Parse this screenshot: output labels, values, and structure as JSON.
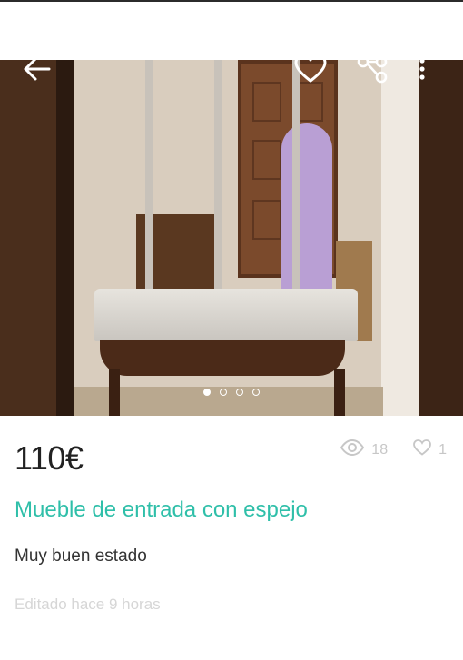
{
  "listing": {
    "price": "110€",
    "title": "Mueble de entrada con espejo",
    "description": "Muy buen estado",
    "edited": "Editado hace 9 horas",
    "views": "18",
    "favorites": "1"
  },
  "gallery": {
    "image_count": 4,
    "active_index": 0
  },
  "icons": {
    "back": "back-arrow-icon",
    "favorite": "heart-icon",
    "share": "share-icon",
    "more": "more-vertical-icon",
    "views": "eye-icon",
    "favorites_count": "heart-outline-icon"
  },
  "colors": {
    "title": "#2fbfa9",
    "price": "#222222",
    "muted": "#c7c7c7"
  }
}
